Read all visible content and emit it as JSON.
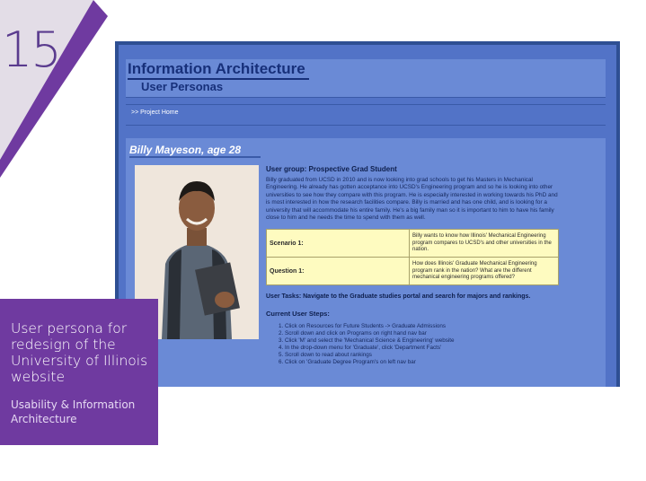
{
  "slide": {
    "number": "15"
  },
  "overlay": {
    "title": "User persona for redesign of  the University of Illinois website",
    "subtitle": "Usability & Information Architecture"
  },
  "screenshot": {
    "site_title": "Information Architecture",
    "site_subtitle": "User Personas",
    "nav_link": ">> Project Home",
    "persona": {
      "name": "Billy Mayeson, age 28",
      "user_group": "User group: Prospective Grad Student",
      "bio": "Billy graduated from UCSD in 2010 and is now looking into grad schools to get his Masters in Mechanical Engineering. He already has gotten acceptance into UCSD's Engineering program and so he is looking into other universities to see how they compare with this program. He is especially interested in working towards his PhD and is most interested in how the research facilities compare. Billy is married and has one child, and is looking for a university that will accommodate his entire family. He's a big family man so it is important to him to have his family close to him and he needs the time to spend with them as well.",
      "scenario_label": "Scenario 1:",
      "scenario_text": "Billy wants to know how Illinois' Mechanical Engineering program compares to UCSD's and other universities in the nation.",
      "question_label": "Question 1:",
      "question_text": "How does Illinois' Graduate Mechanical Engineering program rank in the nation? What are the different mechanical engineering programs offered?",
      "user_tasks": "User Tasks: Navigate to the Graduate studies portal and search for majors and rankings.",
      "steps_heading": "Current User Steps:",
      "steps": [
        "Click on Resources for Future Students -> Graduate Admissions",
        "Scroll down and click on Programs on right hand nav bar",
        "Click 'M' and select the 'Mechanical Science & Engineering' website",
        "In the drop-down menu for 'Graduate', click 'Department Facts'",
        "Scroll down to read about rankings",
        "Click on 'Graduate Degree Program's on left nav bar"
      ]
    }
  },
  "colors": {
    "accent_purple": "#6f3aa0",
    "site_blue": "#5273c7",
    "title_navy": "#17307a",
    "table_yellow": "#fefbc0"
  }
}
